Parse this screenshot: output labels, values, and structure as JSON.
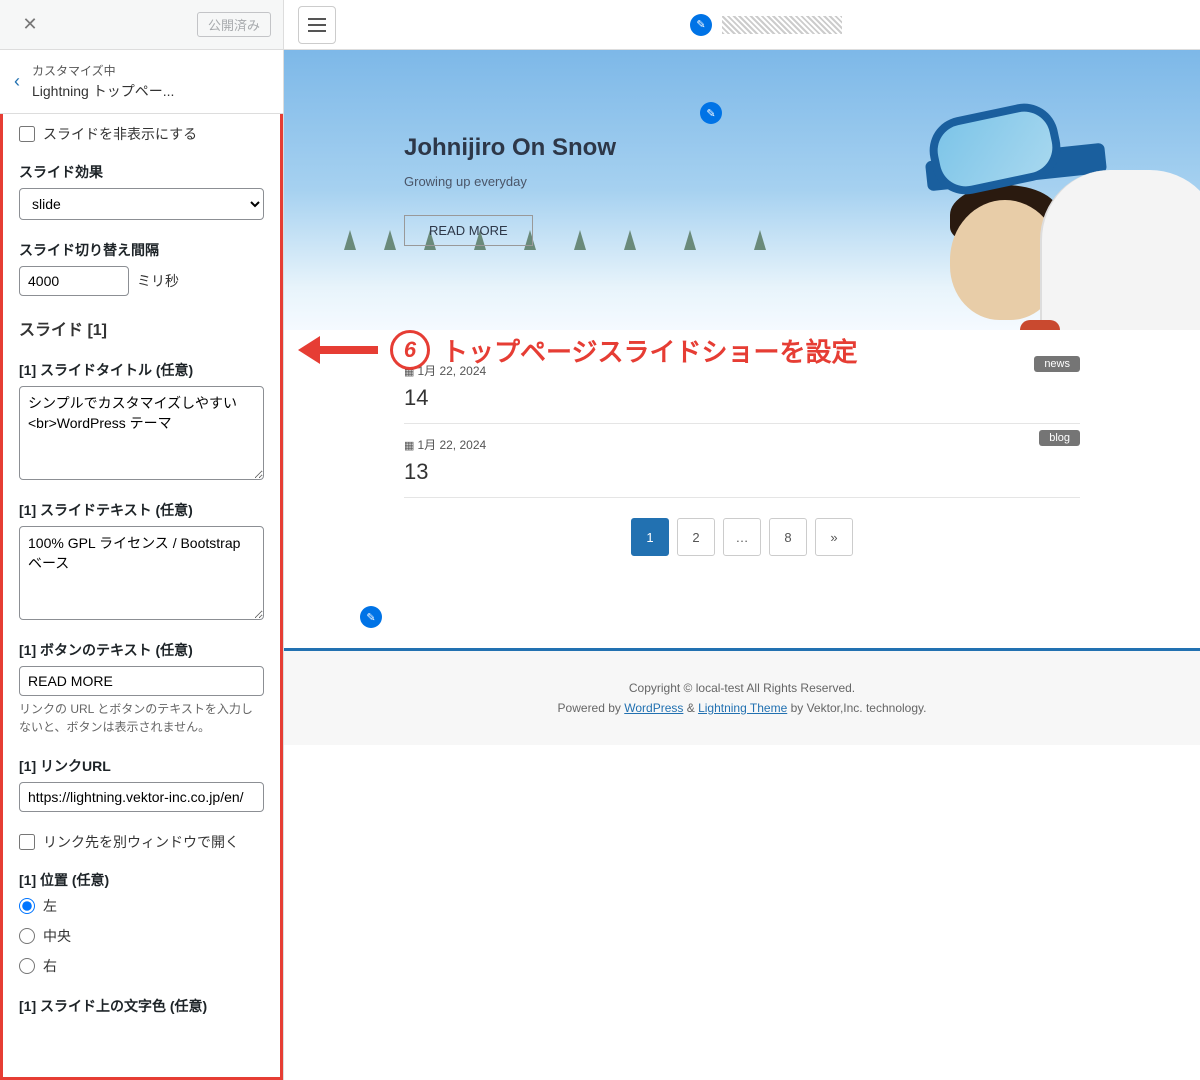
{
  "sidebar": {
    "publish": "公開済み",
    "heading_small": "カスタマイズ中",
    "heading": "Lightning トップペー...",
    "hide_slide": "スライドを非表示にする",
    "effect_label": "スライド効果",
    "effect_value": "slide",
    "interval_label": "スライド切り替え間隔",
    "interval_value": "4000",
    "interval_unit": "ミリ秒",
    "section": "スライド [1]",
    "title_label": "[1] スライドタイトル (任意)",
    "title_value": "シンプルでカスタマイズしやすい <br>WordPress テーマ",
    "text_label": "[1] スライドテキスト (任意)",
    "text_value": "100% GPL ライセンス / Bootstrap ベース",
    "btn_label": "[1] ボタンのテキスト (任意)",
    "btn_value": "READ MORE",
    "btn_note": "リンクの URL とボタンのテキストを入力しないと、ボタンは表示されません。",
    "url_label": "[1] リンクURL",
    "url_value": "https://lightning.vektor-inc.co.jp/en/",
    "newwin": "リンク先を別ウィンドウで開く",
    "pos_label": "[1] 位置 (任意)",
    "pos": [
      "左",
      "中央",
      "右"
    ],
    "color_label": "[1] スライド上の文字色 (任意)"
  },
  "hero": {
    "title": "Johnijiro On Snow",
    "subtitle": "Growing up everyday",
    "button": "READ MORE"
  },
  "annotation": {
    "num": "6",
    "text": "トップページスライドショーを設定"
  },
  "posts": [
    {
      "date": "1月 22, 2024",
      "title": "14",
      "tag": "news"
    },
    {
      "date": "1月 22, 2024",
      "title": "13",
      "tag": "blog"
    }
  ],
  "pager": [
    "1",
    "2",
    "…",
    "8",
    "»"
  ],
  "footer": {
    "copyright": "Copyright © local-test All Rights Reserved.",
    "powered_pre": "Powered by ",
    "wp": "WordPress",
    "amp": " & ",
    "theme": "Lightning Theme",
    "post": " by Vektor,Inc. technology."
  }
}
